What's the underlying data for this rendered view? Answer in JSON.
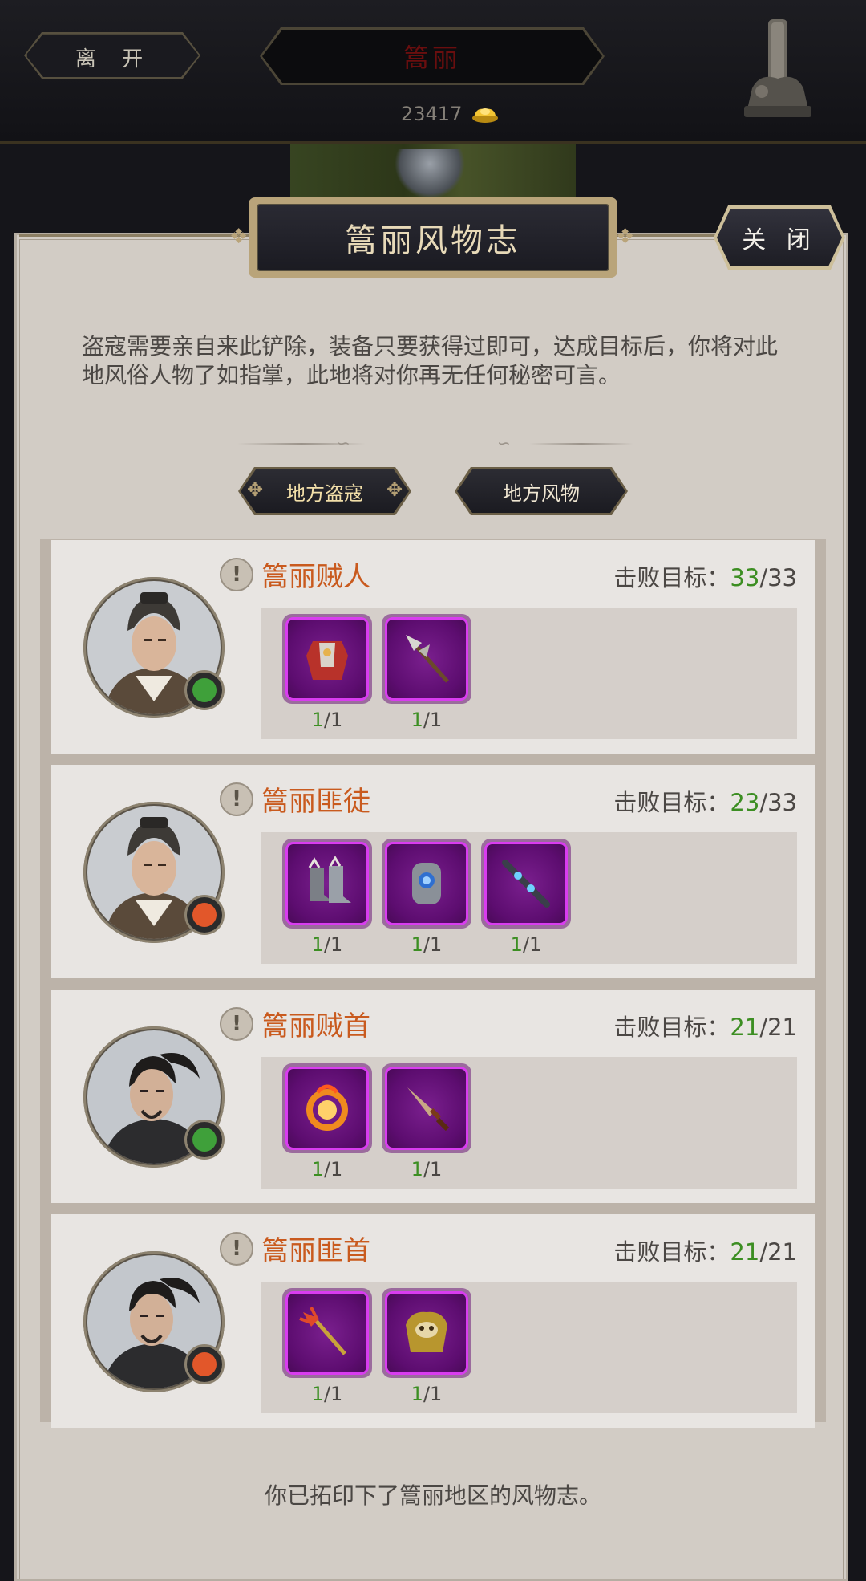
{
  "topbar": {
    "leave_label": "离 开",
    "region_name": "篙丽",
    "gold_amount": "23417"
  },
  "panel": {
    "title": "篙丽风物志",
    "close_label": "关 闭",
    "intro": "盗寇需要亲自来此铲除，装备只要获得过即可，达成目标后，你将对此地风俗人物了如指掌，此地将对你再无任何秘密可言。",
    "tabs": [
      {
        "label": "地方盗寇",
        "active": true
      },
      {
        "label": "地方风物",
        "active": false
      }
    ],
    "footer": "你已拓印下了篙丽地区的风物志。"
  },
  "enemies": [
    {
      "name": "篙丽贼人",
      "defeat_label": "击败目标：",
      "defeated": "33",
      "total": "/33",
      "attack_color": "#3fa03a",
      "portrait": "helmet",
      "items": [
        {
          "icon": "red-armor-icon",
          "got": "1",
          "total": "/1"
        },
        {
          "icon": "halberd-icon",
          "got": "1",
          "total": "/1"
        }
      ]
    },
    {
      "name": "篙丽匪徒",
      "defeat_label": "击败目标：",
      "defeated": "23",
      "total": "/33",
      "attack_color": "#e2572a",
      "portrait": "helmet",
      "items": [
        {
          "icon": "boots-icon",
          "got": "1",
          "total": "/1"
        },
        {
          "icon": "bracer-icon",
          "got": "1",
          "total": "/1"
        },
        {
          "icon": "staff-icon",
          "got": "1",
          "total": "/1"
        }
      ]
    },
    {
      "name": "篙丽贼首",
      "defeat_label": "击败目标：",
      "defeated": "21",
      "total": "/21",
      "attack_color": "#3fa03a",
      "portrait": "topknot",
      "items": [
        {
          "icon": "fire-ring-icon",
          "got": "1",
          "total": "/1"
        },
        {
          "icon": "dagger-icon",
          "got": "1",
          "total": "/1"
        }
      ]
    },
    {
      "name": "篙丽匪首",
      "defeat_label": "击败目标：",
      "defeated": "21",
      "total": "/21",
      "attack_color": "#e2572a",
      "portrait": "topknot",
      "items": [
        {
          "icon": "trident-icon",
          "got": "1",
          "total": "/1"
        },
        {
          "icon": "beast-armor-icon",
          "got": "1",
          "total": "/1"
        }
      ]
    }
  ]
}
